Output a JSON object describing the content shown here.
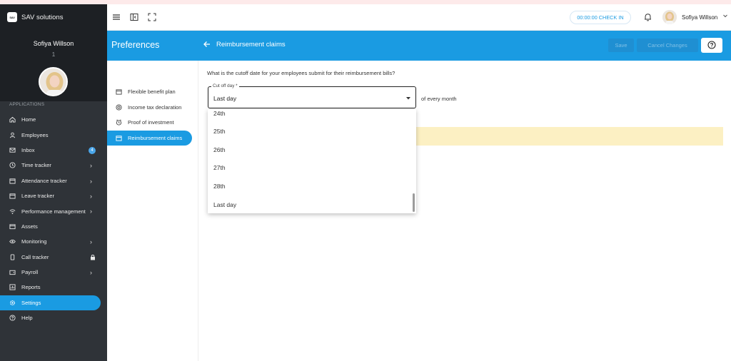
{
  "brand": {
    "logo_text": "SAV",
    "name": "SAV solutions"
  },
  "user": {
    "name": "Sofiya Willson",
    "id": "1"
  },
  "sidebar": {
    "section": "APPLICATIONS",
    "items": [
      {
        "label": "Home",
        "icon": "home-icon"
      },
      {
        "label": "Employees",
        "icon": "users-icon"
      },
      {
        "label": "Inbox",
        "icon": "mail-icon",
        "badge": "4"
      },
      {
        "label": "Time tracker",
        "icon": "clock-icon",
        "chevron": true
      },
      {
        "label": "Attendance tracker",
        "icon": "calendar-icon",
        "chevron": true
      },
      {
        "label": "Leave tracker",
        "icon": "calendar-icon",
        "chevron": true
      },
      {
        "label": "Performance management",
        "icon": "wifi-icon",
        "chevron": true
      },
      {
        "label": "Assets",
        "icon": "box-icon"
      },
      {
        "label": "Monitoring",
        "icon": "eye-icon",
        "chevron": true
      },
      {
        "label": "Call tracker",
        "icon": "phone-icon",
        "lock": true
      },
      {
        "label": "Payroll",
        "icon": "wallet-icon",
        "chevron": true
      },
      {
        "label": "Reports",
        "icon": "chart-icon"
      },
      {
        "label": "Settings",
        "icon": "gear-icon",
        "active": true
      },
      {
        "label": "Help",
        "icon": "help-icon"
      }
    ]
  },
  "topbar": {
    "checkin": "00:00:00 CHECK IN",
    "user_name": "Sofiya Willson"
  },
  "header": {
    "section_title": "Preferences",
    "page_title": "Reimbursement claims",
    "save_label": "Save",
    "cancel_label": "Cancel Changes"
  },
  "preferences": {
    "items": [
      {
        "label": "Flexible benefit plan"
      },
      {
        "label": "Income tax declaration"
      },
      {
        "label": "Proof of investment"
      },
      {
        "label": "Reimbursement claims",
        "active": true
      }
    ]
  },
  "form": {
    "question": "What is the cutoff date for your employees submit for their reimbursement bills?",
    "field_label": "Cut off day *",
    "value": "Last day",
    "suffix": "of every month"
  },
  "dropdown": {
    "options": [
      "24th",
      "25th",
      "26th",
      "27th",
      "28th",
      "Last day"
    ]
  },
  "colors": {
    "accent": "#1a9be2",
    "sidebar": "#2f3338",
    "warning_bg": "#fcf0c3"
  }
}
